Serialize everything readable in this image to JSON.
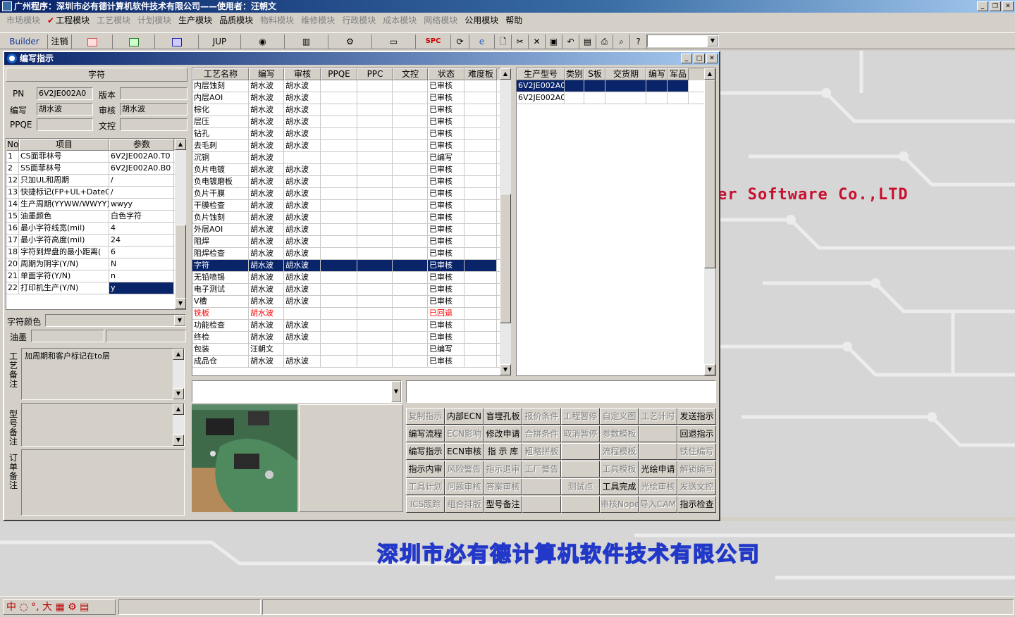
{
  "app": {
    "title": "广州程序：深圳市必有德计算机软件技术有限公司——使用者：汪朝文"
  },
  "menu": [
    {
      "label": "市场模块",
      "on": false
    },
    {
      "label": "工程模块",
      "on": true,
      "checked": true
    },
    {
      "label": "工艺模块",
      "on": false
    },
    {
      "label": "计划模块",
      "on": false
    },
    {
      "label": "生产模块",
      "on": true
    },
    {
      "label": "品质模块",
      "on": true
    },
    {
      "label": "物料模块",
      "on": false
    },
    {
      "label": "维修模块",
      "on": false
    },
    {
      "label": "行政模块",
      "on": false
    },
    {
      "label": "成本模块",
      "on": false
    },
    {
      "label": "网络模块",
      "on": false
    },
    {
      "label": "公用模块",
      "on": true
    },
    {
      "label": "帮助",
      "on": true
    }
  ],
  "toolbar": {
    "builder": "Builder",
    "logout": "注销",
    "jup": "JUP",
    "spc": "SPC"
  },
  "window": {
    "title": "编写指示"
  },
  "left": {
    "header": "字符",
    "pn_label": "PN",
    "pn_value": "6V2JE002A0",
    "version_label": "版本",
    "version_value": "",
    "writer_label": "编写",
    "writer_value": "胡水波",
    "review_label": "审核",
    "review_value": "胡水波",
    "ppqe_label": "PPQE",
    "ppqe_value": "",
    "doc_label": "文控",
    "doc_value": "",
    "param_headers": [
      "No",
      "项目",
      "参数"
    ],
    "params": [
      [
        "1",
        "CS面菲林号",
        "6V2JE002A0.T0"
      ],
      [
        "2",
        "SS面菲林号",
        "6V2JE002A0.B0"
      ],
      [
        "12",
        "只加UL和周期",
        "/"
      ],
      [
        "13",
        "快捷标记(FP+UL+DateCo",
        "/"
      ],
      [
        "14",
        "生产周期(YYWW/WWYY)",
        "wwyy"
      ],
      [
        "15",
        "油墨颜色",
        "白色字符"
      ],
      [
        "16",
        "最小字符线宽(mil)",
        "4"
      ],
      [
        "17",
        "最小字符高度(mil)",
        "24"
      ],
      [
        "18",
        "字符到焊盘的最小距离(",
        "6"
      ],
      [
        "20",
        "周期为阴字(Y/N)",
        "N"
      ],
      [
        "21",
        "单面字符(Y/N)",
        "n"
      ],
      [
        "22",
        "打印机生产(Y/N)",
        "y"
      ]
    ],
    "char_color_label": "字符颜色",
    "ink_label": "油墨",
    "process_note_label": "工艺备注",
    "process_note": "加周期和客户标记在to层",
    "model_note_label": "型号备注",
    "order_note_label": "订单备注"
  },
  "process": {
    "headers": [
      "工艺名称",
      "编写",
      "审核",
      "PPQE",
      "PPC",
      "文控",
      "状态",
      "难度板"
    ],
    "rows": [
      [
        "内层蚀刻",
        "胡水波",
        "胡水波",
        "",
        "",
        "",
        "已审核",
        ""
      ],
      [
        "内层AOI",
        "胡水波",
        "胡水波",
        "",
        "",
        "",
        "已审核",
        ""
      ],
      [
        "棕化",
        "胡水波",
        "胡水波",
        "",
        "",
        "",
        "已审核",
        ""
      ],
      [
        "层压",
        "胡水波",
        "胡水波",
        "",
        "",
        "",
        "已审核",
        ""
      ],
      [
        "钻孔",
        "胡水波",
        "胡水波",
        "",
        "",
        "",
        "已审核",
        ""
      ],
      [
        "去毛刺",
        "胡水波",
        "胡水波",
        "",
        "",
        "",
        "已审核",
        ""
      ],
      [
        "沉铜",
        "胡水波",
        "",
        "",
        "",
        "",
        "已编写",
        ""
      ],
      [
        "负片电镀",
        "胡水波",
        "胡水波",
        "",
        "",
        "",
        "已审核",
        ""
      ],
      [
        "负电镀磨板",
        "胡水波",
        "胡水波",
        "",
        "",
        "",
        "已审核",
        ""
      ],
      [
        "负片干膜",
        "胡水波",
        "胡水波",
        "",
        "",
        "",
        "已审核",
        ""
      ],
      [
        "干膜检查",
        "胡水波",
        "胡水波",
        "",
        "",
        "",
        "已审核",
        ""
      ],
      [
        "负片蚀刻",
        "胡水波",
        "胡水波",
        "",
        "",
        "",
        "已审核",
        ""
      ],
      [
        "外层AOI",
        "胡水波",
        "胡水波",
        "",
        "",
        "",
        "已审核",
        ""
      ],
      [
        "阻焊",
        "胡水波",
        "胡水波",
        "",
        "",
        "",
        "已审核",
        ""
      ],
      [
        "阻焊检查",
        "胡水波",
        "胡水波",
        "",
        "",
        "",
        "已审核",
        ""
      ],
      [
        "字符",
        "胡水波",
        "胡水波",
        "",
        "",
        "",
        "已审核",
        ""
      ],
      [
        "无铅喷锡",
        "胡水波",
        "胡水波",
        "",
        "",
        "",
        "已审核",
        ""
      ],
      [
        "电子测试",
        "胡水波",
        "胡水波",
        "",
        "",
        "",
        "已审核",
        ""
      ],
      [
        "V槽",
        "胡水波",
        "胡水波",
        "",
        "",
        "",
        "已审核",
        ""
      ],
      [
        "铣板",
        "胡水波",
        "",
        "",
        "",
        "",
        "已回退",
        ""
      ],
      [
        "功能检查",
        "胡水波",
        "胡水波",
        "",
        "",
        "",
        "已审核",
        ""
      ],
      [
        "终检",
        "胡水波",
        "胡水波",
        "",
        "",
        "",
        "已审核",
        ""
      ],
      [
        "包装",
        "汪朝文",
        "",
        "",
        "",
        "",
        "已编写",
        ""
      ],
      [
        "成品仓",
        "胡水波",
        "胡水波",
        "",
        "",
        "",
        "已审核",
        ""
      ]
    ]
  },
  "models": {
    "headers": [
      "生产型号",
      "类别",
      "S板",
      "交货期",
      "编写",
      "军品"
    ],
    "rows": [
      [
        "6V2JE002A0",
        "",
        "",
        "",
        "",
        ""
      ],
      [
        "6V2JE002A0",
        "",
        "",
        "",
        "",
        ""
      ]
    ]
  },
  "buttons": [
    [
      "复制指示",
      "内部ECN",
      "盲埋孔板",
      "报价条件",
      "工程暂停",
      "自定义图",
      "工艺计时",
      "发送指示"
    ],
    [
      "编写流程",
      "ECN影响",
      "修改申请",
      "合拼条件",
      "取消暂停",
      "参数模板",
      "",
      "回退指示"
    ],
    [
      "编写指示",
      "ECN审核",
      "指 示 库",
      "粗略拼板",
      "",
      "流程模板",
      "",
      "锁住编写"
    ],
    [
      "指示内审",
      "风险警告",
      "指示退审",
      "工厂警告",
      "",
      "工具模板",
      "光绘申请",
      "解锁编写"
    ],
    [
      "工具计划",
      "问题审核",
      "答案审核",
      "",
      "测试点",
      "工具完成",
      "光绘审核",
      "发送文控"
    ],
    [
      "ICS跟踪",
      "组合排版",
      "型号备注",
      "",
      "",
      "审核Nope",
      "导入CAM",
      "指示检查"
    ]
  ],
  "buttons_disabled": [
    [
      true,
      false,
      false,
      true,
      true,
      true,
      true,
      false
    ],
    [
      false,
      true,
      false,
      true,
      true,
      true,
      false,
      false
    ],
    [
      false,
      false,
      false,
      true,
      false,
      true,
      false,
      true
    ],
    [
      false,
      true,
      true,
      true,
      false,
      true,
      false,
      true
    ],
    [
      true,
      true,
      true,
      false,
      true,
      false,
      true,
      true
    ],
    [
      true,
      true,
      false,
      false,
      false,
      true,
      true,
      false
    ]
  ],
  "brand_text": "er Software Co.,LTD",
  "company_text": "深圳市必有德计算机软件技术有限公司",
  "statusbar": {
    "ime": "中 ◌ °, 大 ▦ ⚙ ▤"
  },
  "colors": {
    "title_bg": "#0a246a",
    "selection": "#0a246a",
    "brand_red": "#c8102e",
    "company_blue": "#2238c8"
  }
}
